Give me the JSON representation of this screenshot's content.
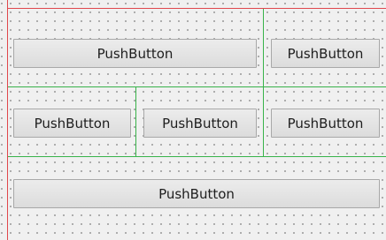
{
  "form": {
    "row1": {
      "left_button": "PushButton",
      "right_button": "PushButton"
    },
    "row2": {
      "button_1": "PushButton",
      "button_2": "PushButton",
      "button_3": "PushButton"
    },
    "row3": {
      "wide_button": "PushButton"
    }
  },
  "colors": {
    "form_border": "#e0474c",
    "layout_lines": "#38b34a",
    "grid_dots": "#8a8a8a",
    "background": "#f0f0f0"
  }
}
